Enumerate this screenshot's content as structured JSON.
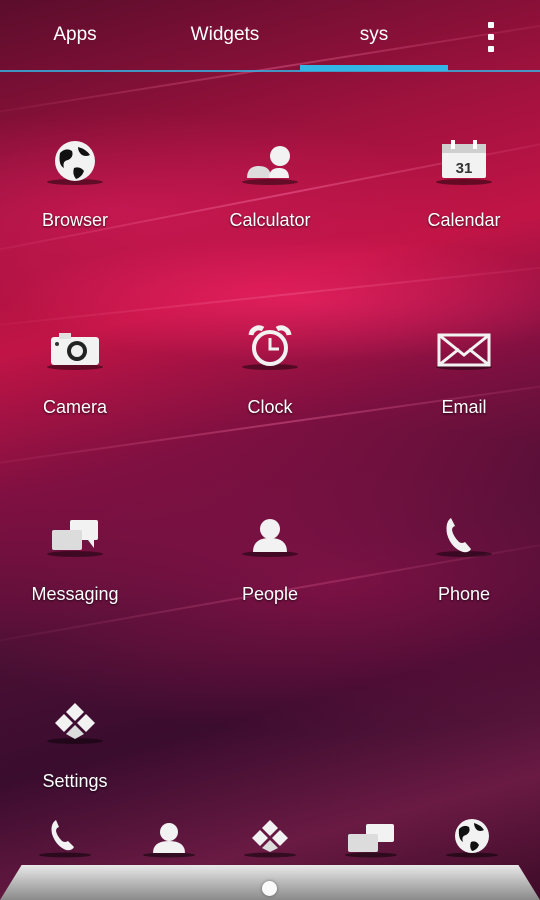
{
  "tabs": [
    {
      "label": "Apps",
      "selected": false
    },
    {
      "label": "Widgets",
      "selected": false
    },
    {
      "label": "sys",
      "selected": true
    }
  ],
  "accent_color": "#33b5e5",
  "overflow_icon": "more-vert-icon",
  "apps": [
    {
      "label": "Browser",
      "icon": "globe-icon"
    },
    {
      "label": "Calculator",
      "icon": "calculator-icon"
    },
    {
      "label": "Calendar",
      "icon": "calendar-icon",
      "icon_text": "31"
    },
    {
      "label": "Camera",
      "icon": "camera-icon"
    },
    {
      "label": "Clock",
      "icon": "alarm-clock-icon"
    },
    {
      "label": "Email",
      "icon": "envelope-icon"
    },
    {
      "label": "Messaging",
      "icon": "chat-bubbles-icon"
    },
    {
      "label": "People",
      "icon": "person-icon"
    },
    {
      "label": "Phone",
      "icon": "phone-handset-icon"
    },
    {
      "label": "Settings",
      "icon": "diamond-tiles-icon"
    }
  ],
  "dock": [
    {
      "icon": "phone-handset-icon"
    },
    {
      "icon": "person-icon"
    },
    {
      "icon": "diamond-tiles-icon"
    },
    {
      "icon": "chat-bubbles-icon"
    },
    {
      "icon": "globe-icon"
    }
  ]
}
